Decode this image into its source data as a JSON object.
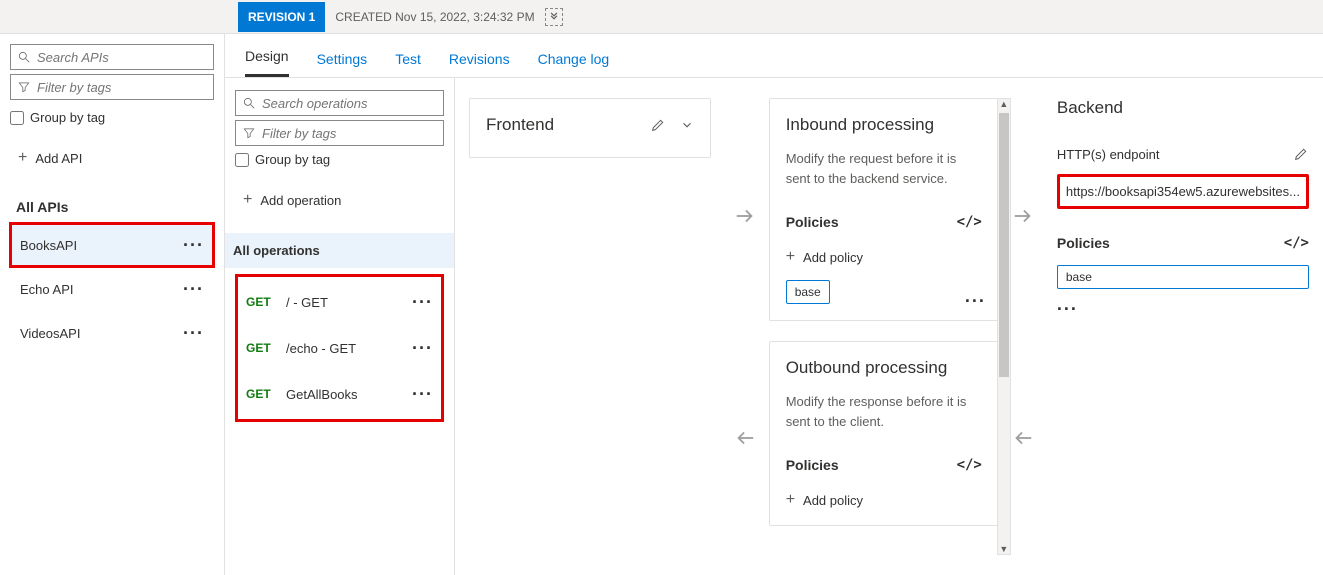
{
  "revision_bar": {
    "badge": "REVISION 1",
    "created": "CREATED Nov 15, 2022, 3:24:32 PM"
  },
  "left": {
    "search_placeholder": "Search APIs",
    "filter_placeholder": "Filter by tags",
    "group_label": "Group by tag",
    "add_api": "Add API",
    "all_apis": "All APIs",
    "apis": [
      {
        "name": "BooksAPI",
        "selected": true,
        "highlight": true
      },
      {
        "name": "Echo API",
        "selected": false,
        "highlight": false
      },
      {
        "name": "VideosAPI",
        "selected": false,
        "highlight": false
      }
    ]
  },
  "tabs": [
    {
      "label": "Design",
      "active": true
    },
    {
      "label": "Settings",
      "active": false
    },
    {
      "label": "Test",
      "active": false
    },
    {
      "label": "Revisions",
      "active": false
    },
    {
      "label": "Change log",
      "active": false
    }
  ],
  "ops": {
    "search_placeholder": "Search operations",
    "filter_placeholder": "Filter by tags",
    "group_label": "Group by tag",
    "add_op": "Add operation",
    "all_ops": "All operations",
    "list": [
      {
        "method": "GET",
        "name": "/ - GET"
      },
      {
        "method": "GET",
        "name": "/echo - GET"
      },
      {
        "method": "GET",
        "name": "GetAllBooks"
      }
    ]
  },
  "frontend": {
    "title": "Frontend"
  },
  "inbound": {
    "title": "Inbound processing",
    "sub": "Modify the request before it is sent to the backend service.",
    "policies": "Policies",
    "add_policy": "Add policy",
    "base": "base"
  },
  "outbound": {
    "title": "Outbound processing",
    "sub": "Modify the response before it is sent to the client.",
    "policies": "Policies",
    "add_policy": "Add policy"
  },
  "backend": {
    "title": "Backend",
    "endpoint_label": "HTTP(s) endpoint",
    "endpoint_value": "https://booksapi354ew5.azurewebsites...",
    "policies": "Policies",
    "base": "base"
  }
}
